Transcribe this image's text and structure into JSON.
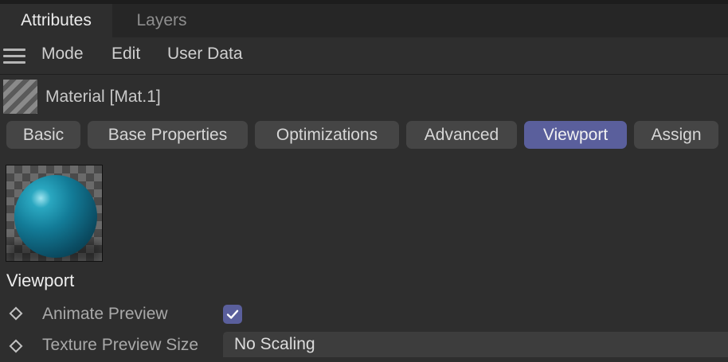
{
  "panel_tabs": {
    "attributes": "Attributes",
    "layers": "Layers"
  },
  "menu": {
    "mode": "Mode",
    "edit": "Edit",
    "user_data": "User Data"
  },
  "object": {
    "title": "Material [Mat.1]"
  },
  "subtabs": [
    "Basic",
    "Base Properties",
    "Optimizations",
    "Advanced",
    "Viewport",
    "Assign"
  ],
  "active_subtab": "Viewport",
  "section": {
    "title": "Viewport"
  },
  "params": {
    "animate_preview": {
      "label": "Animate Preview",
      "checked": true
    },
    "texture_preview_size": {
      "label": "Texture Preview Size",
      "value": "No Scaling"
    }
  },
  "colors": {
    "accent": "#5a5f9c",
    "background": "#2e2e2e",
    "sphere": "#137c98"
  },
  "icons": [
    "hamburger-menu-icon",
    "material-icon",
    "keyframe-diamond-icon",
    "checkmark-icon"
  ]
}
